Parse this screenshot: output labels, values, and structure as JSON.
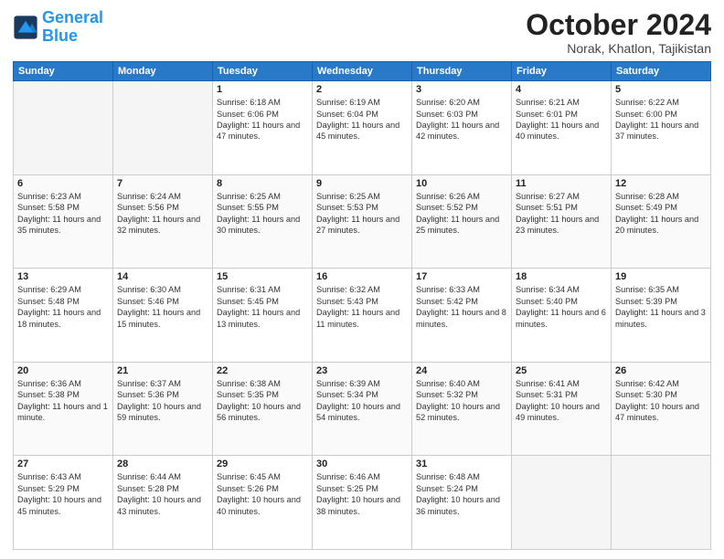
{
  "header": {
    "logo_line1": "General",
    "logo_line2": "Blue",
    "month_title": "October 2024",
    "location": "Norak, Khatlon, Tajikistan"
  },
  "days_of_week": [
    "Sunday",
    "Monday",
    "Tuesday",
    "Wednesday",
    "Thursday",
    "Friday",
    "Saturday"
  ],
  "weeks": [
    [
      {
        "day": "",
        "info": ""
      },
      {
        "day": "",
        "info": ""
      },
      {
        "day": "1",
        "info": "Sunrise: 6:18 AM\nSunset: 6:06 PM\nDaylight: 11 hours and 47 minutes."
      },
      {
        "day": "2",
        "info": "Sunrise: 6:19 AM\nSunset: 6:04 PM\nDaylight: 11 hours and 45 minutes."
      },
      {
        "day": "3",
        "info": "Sunrise: 6:20 AM\nSunset: 6:03 PM\nDaylight: 11 hours and 42 minutes."
      },
      {
        "day": "4",
        "info": "Sunrise: 6:21 AM\nSunset: 6:01 PM\nDaylight: 11 hours and 40 minutes."
      },
      {
        "day": "5",
        "info": "Sunrise: 6:22 AM\nSunset: 6:00 PM\nDaylight: 11 hours and 37 minutes."
      }
    ],
    [
      {
        "day": "6",
        "info": "Sunrise: 6:23 AM\nSunset: 5:58 PM\nDaylight: 11 hours and 35 minutes."
      },
      {
        "day": "7",
        "info": "Sunrise: 6:24 AM\nSunset: 5:56 PM\nDaylight: 11 hours and 32 minutes."
      },
      {
        "day": "8",
        "info": "Sunrise: 6:25 AM\nSunset: 5:55 PM\nDaylight: 11 hours and 30 minutes."
      },
      {
        "day": "9",
        "info": "Sunrise: 6:25 AM\nSunset: 5:53 PM\nDaylight: 11 hours and 27 minutes."
      },
      {
        "day": "10",
        "info": "Sunrise: 6:26 AM\nSunset: 5:52 PM\nDaylight: 11 hours and 25 minutes."
      },
      {
        "day": "11",
        "info": "Sunrise: 6:27 AM\nSunset: 5:51 PM\nDaylight: 11 hours and 23 minutes."
      },
      {
        "day": "12",
        "info": "Sunrise: 6:28 AM\nSunset: 5:49 PM\nDaylight: 11 hours and 20 minutes."
      }
    ],
    [
      {
        "day": "13",
        "info": "Sunrise: 6:29 AM\nSunset: 5:48 PM\nDaylight: 11 hours and 18 minutes."
      },
      {
        "day": "14",
        "info": "Sunrise: 6:30 AM\nSunset: 5:46 PM\nDaylight: 11 hours and 15 minutes."
      },
      {
        "day": "15",
        "info": "Sunrise: 6:31 AM\nSunset: 5:45 PM\nDaylight: 11 hours and 13 minutes."
      },
      {
        "day": "16",
        "info": "Sunrise: 6:32 AM\nSunset: 5:43 PM\nDaylight: 11 hours and 11 minutes."
      },
      {
        "day": "17",
        "info": "Sunrise: 6:33 AM\nSunset: 5:42 PM\nDaylight: 11 hours and 8 minutes."
      },
      {
        "day": "18",
        "info": "Sunrise: 6:34 AM\nSunset: 5:40 PM\nDaylight: 11 hours and 6 minutes."
      },
      {
        "day": "19",
        "info": "Sunrise: 6:35 AM\nSunset: 5:39 PM\nDaylight: 11 hours and 3 minutes."
      }
    ],
    [
      {
        "day": "20",
        "info": "Sunrise: 6:36 AM\nSunset: 5:38 PM\nDaylight: 11 hours and 1 minute."
      },
      {
        "day": "21",
        "info": "Sunrise: 6:37 AM\nSunset: 5:36 PM\nDaylight: 10 hours and 59 minutes."
      },
      {
        "day": "22",
        "info": "Sunrise: 6:38 AM\nSunset: 5:35 PM\nDaylight: 10 hours and 56 minutes."
      },
      {
        "day": "23",
        "info": "Sunrise: 6:39 AM\nSunset: 5:34 PM\nDaylight: 10 hours and 54 minutes."
      },
      {
        "day": "24",
        "info": "Sunrise: 6:40 AM\nSunset: 5:32 PM\nDaylight: 10 hours and 52 minutes."
      },
      {
        "day": "25",
        "info": "Sunrise: 6:41 AM\nSunset: 5:31 PM\nDaylight: 10 hours and 49 minutes."
      },
      {
        "day": "26",
        "info": "Sunrise: 6:42 AM\nSunset: 5:30 PM\nDaylight: 10 hours and 47 minutes."
      }
    ],
    [
      {
        "day": "27",
        "info": "Sunrise: 6:43 AM\nSunset: 5:29 PM\nDaylight: 10 hours and 45 minutes."
      },
      {
        "day": "28",
        "info": "Sunrise: 6:44 AM\nSunset: 5:28 PM\nDaylight: 10 hours and 43 minutes."
      },
      {
        "day": "29",
        "info": "Sunrise: 6:45 AM\nSunset: 5:26 PM\nDaylight: 10 hours and 40 minutes."
      },
      {
        "day": "30",
        "info": "Sunrise: 6:46 AM\nSunset: 5:25 PM\nDaylight: 10 hours and 38 minutes."
      },
      {
        "day": "31",
        "info": "Sunrise: 6:48 AM\nSunset: 5:24 PM\nDaylight: 10 hours and 36 minutes."
      },
      {
        "day": "",
        "info": ""
      },
      {
        "day": "",
        "info": ""
      }
    ]
  ]
}
